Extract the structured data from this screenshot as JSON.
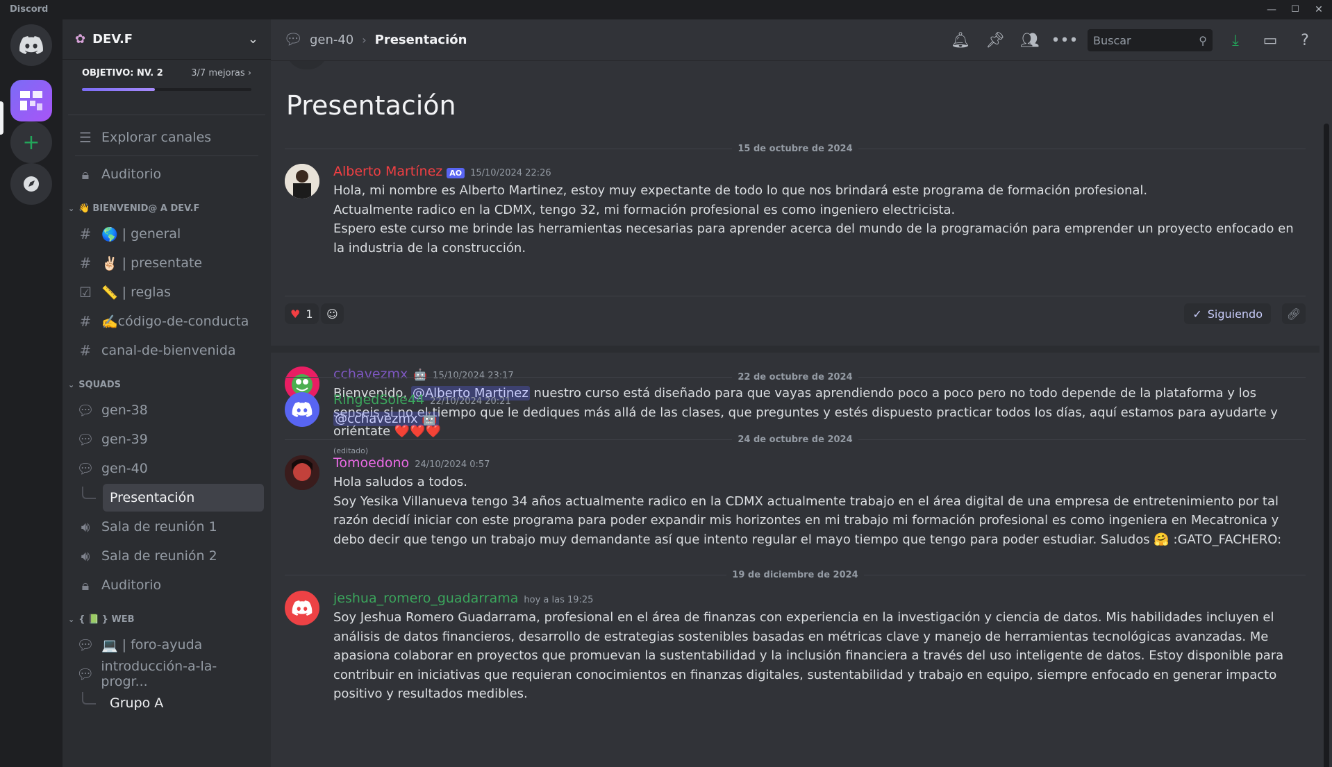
{
  "app": {
    "title": "Discord"
  },
  "window": {
    "minimize": "—",
    "maximize": "☐",
    "close": "✕"
  },
  "server": {
    "name": "DEV.F",
    "goal_label": "OBJETIVO: NV. 2",
    "goal_count": "3/7 mejoras",
    "goal_progress": 0.43
  },
  "sidebar": {
    "explore": "Explorar canales",
    "auditorio_top": "Auditorio",
    "cat1": "BIENVENID@ A DEV.F",
    "cat1_icon": "👋",
    "welcome_channels": [
      {
        "emoji": "🌎",
        "label": "| general"
      },
      {
        "emoji": "✌🏻",
        "label": "| presentate"
      },
      {
        "emoji": "📏",
        "label": "| reglas"
      },
      {
        "emoji": "✍️",
        "label": "código-de-conducta"
      },
      {
        "emoji": "",
        "label": "canal-de-bienvenida"
      }
    ],
    "cat2": "SQUADS",
    "squads": [
      "gen-38",
      "gen-39",
      "gen-40"
    ],
    "active_thread": "Presentación",
    "voice": [
      "Sala de reunión 1",
      "Sala de reunión 2"
    ],
    "auditorio": "Auditorio",
    "cat3_prefix": "{",
    "cat3_icon": "📗",
    "cat3_suffix": "} WEB",
    "web": [
      {
        "emoji": "💻",
        "label": "| foro-ayuda"
      },
      {
        "emoji": "",
        "label": "introducción-a-la-progr..."
      }
    ],
    "web_thread": "Grupo A"
  },
  "topbar": {
    "channel": "gen-40",
    "thread": "Presentación",
    "search_placeholder": "Buscar"
  },
  "post": {
    "title": "Presentación",
    "follow_label": "Siguiendo",
    "reaction_heart_count": "1"
  },
  "dates": [
    "15 de octubre de 2024",
    "22 de octubre de 2024",
    "24 de octubre de 2024",
    "19 de diciembre de 2024"
  ],
  "messages": [
    {
      "author": "Alberto Martínez",
      "tag": "AO",
      "time": "15/10/2024 22:26",
      "color": "#f23f43",
      "lines": [
        "Hola, mi nombre es Alberto Martinez, estoy muy expectante de todo lo que nos brindará este programa de formación profesional.",
        "Actualmente radico en la CDMX, tengo 32, mi formación profesional es como ingeniero electricista.",
        "Espero este curso me brinde las herramientas necesarias para aprender acerca del mundo de la programación para emprender un proyecto enfocado en la industria de la construcción."
      ]
    },
    {
      "author": "cchavezmx",
      "time": "15/10/2024 23:17",
      "color": "#7e57c2",
      "pre": "Bienvenido, ",
      "mention": "@Alberto Martinez",
      "text": " nuestro curso está diseñado para que vayas aprendiendo poco a poco pero no todo depende de la plataforma y los senseis si no el tiempo que le dediques más allá de las clases, que preguntes y estés dispuesto practicar todos los días, aquí estamos para ayudarte y oriéntate ",
      "hearts": "❤️❤️❤️",
      "edited": "(editado)"
    },
    {
      "author": "RingedSole44",
      "time": "22/10/2024 20:21",
      "color": "#3ba55c",
      "mention": "@cchavezmx"
    },
    {
      "author": "Tomoedono",
      "time": "24/10/2024 0:57",
      "color": "#eb6be6",
      "first": "Hola saludos a todos.",
      "text": "Soy Yesika Villanueva tengo 34 años actualmente radico en la CDMX actualmente trabajo en el área digital de una empresa de entretenimiento por tal razón decidí iniciar con este programa para poder expandir mis horizontes en mi trabajo mi formación profesional es como ingeniera en Mecatronica y debo decir que tengo un trabajo muy demandante así que intento regular el mayo tiempo que tengo para poder estudiar. Saludos ",
      "emoji": "🤗",
      "suffix": " :GATO_FACHERO:"
    },
    {
      "author": "jeshua_romero_guadarrama",
      "time": "hoy a las 19:25",
      "color": "#3ba55c",
      "text": "Soy Jeshua Romero Guadarrama, profesional en el área de finanzas con experiencia en la investigación y ciencia de datos. Mis habilidades incluyen el análisis de datos financieros, desarrollo de estrategias sostenibles basadas en métricas clave y manejo de herramientas tecnológicas avanzadas. Me apasiona colaborar en proyectos que promuevan la sustentabilidad y la inclusión financiera a través del uso inteligente de datos. Estoy disponible para contribuir en iniciativas que requieran conocimientos en finanzas digitales, sustentabilidad y trabajo en equipo, siempre enfocado en generar impacto positivo  y resultados medibles."
    }
  ]
}
